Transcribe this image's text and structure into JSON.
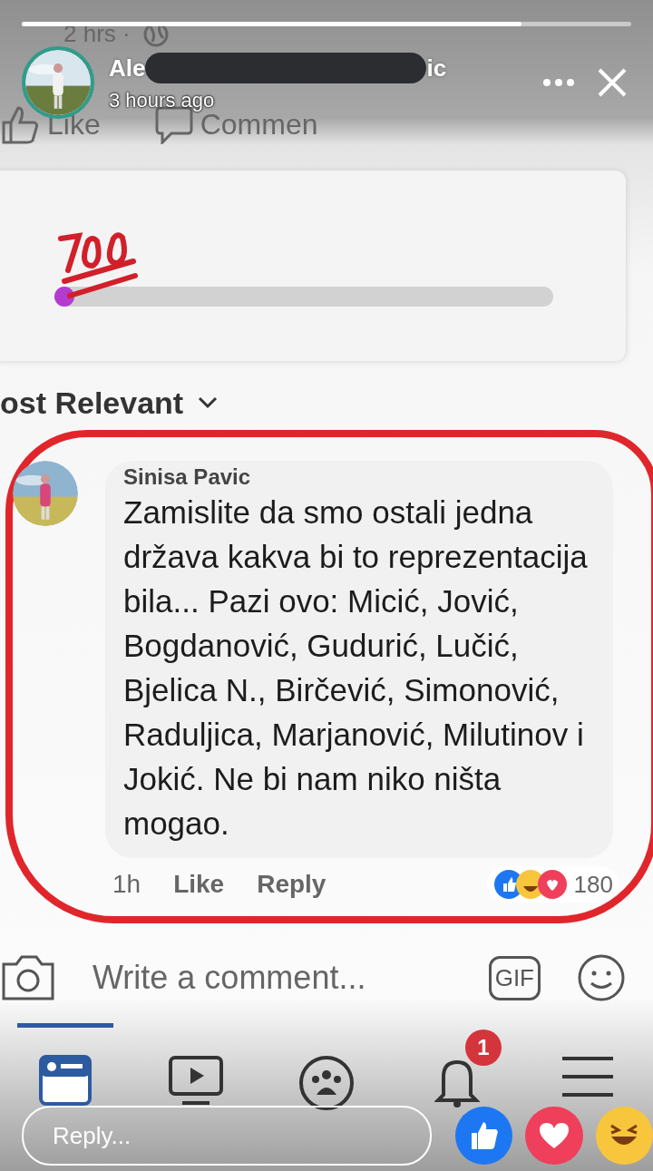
{
  "story": {
    "progress": {
      "level": 0.82
    },
    "author_start": "Ale",
    "author_end": "ic",
    "time": "3 hours ago"
  },
  "post_behind": {
    "time": "2 hrs ·",
    "actions": [
      "Like",
      "Commen"
    ]
  },
  "sticker": {
    "level": 0.03
  },
  "sort": {
    "label": "ost Relevant"
  },
  "comment": {
    "author": "Sinisa Pavic",
    "text": "Zamislite da smo ostali jedna država kakva bi to reprezentacija bila... Pazi ovo: Micić, Jović, Bogdanović, Gudurić, Lučić, Bjelica N., Birčević, Simonović, Raduljica, Marjanović, Milutinov i Jokić. Ne bi nam niko ništa mogao.",
    "time": "1h",
    "actions": [
      "Like",
      "Reply"
    ],
    "reaction_count": "180"
  },
  "composer": {
    "placeholder": "Write a comment...",
    "gif": "GIF"
  },
  "nav": [
    {
      "kind": "feed",
      "selected": true
    },
    {
      "kind": "video",
      "selected": false
    },
    {
      "kind": "groups",
      "selected": false
    },
    {
      "kind": "bell",
      "selected": false,
      "badge": "1"
    },
    {
      "kind": "menu",
      "selected": false
    }
  ],
  "reply": {
    "placeholder": "Reply..."
  }
}
